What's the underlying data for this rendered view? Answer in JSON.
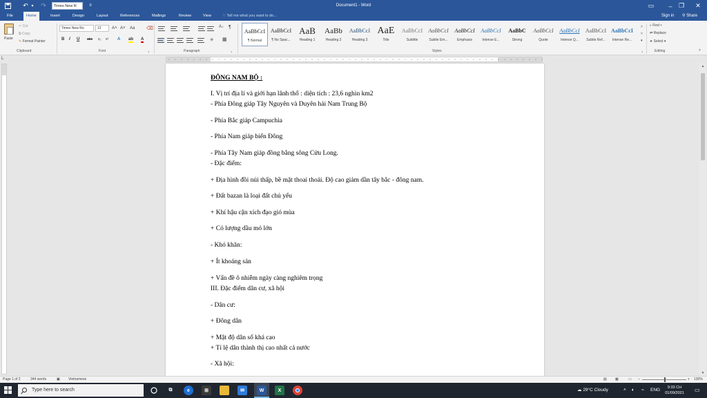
{
  "titlebar": {
    "font_quick": "Times New R",
    "doc_title": "Document1 - Word"
  },
  "tabs": {
    "file": "File",
    "items": [
      "Home",
      "Insert",
      "Design",
      "Layout",
      "References",
      "Mailings",
      "Review",
      "View"
    ],
    "tellme": "Tell me what you want to do...",
    "signin": "Sign in",
    "share": "Share"
  },
  "ribbon": {
    "clipboard": {
      "paste": "Paste",
      "cut": "Cut",
      "copy": "Copy",
      "format_painter": "Format Painter",
      "label": "Clipboard"
    },
    "font": {
      "name": "Times New Ro",
      "size": "12",
      "label": "Font"
    },
    "paragraph": {
      "label": "Paragraph"
    },
    "styles": {
      "label": "Styles",
      "items": [
        {
          "sample": "AaBbCcI",
          "name": "¶ Normal"
        },
        {
          "sample": "AaBbCcI",
          "name": "¶ No Spac..."
        },
        {
          "sample": "AaB",
          "name": "Heading 1"
        },
        {
          "sample": "AaBb",
          "name": "Heading 2"
        },
        {
          "sample": "AaBbCcI",
          "name": "Heading 3"
        },
        {
          "sample": "AaE",
          "name": "Title"
        },
        {
          "sample": "AaBbCcI",
          "name": "Subtitle"
        },
        {
          "sample": "AaBbCcI",
          "name": "Subtle Em..."
        },
        {
          "sample": "AaBbCcI",
          "name": "Emphasis"
        },
        {
          "sample": "AaBbCcI",
          "name": "Intense E..."
        },
        {
          "sample": "AaBbC",
          "name": "Strong"
        },
        {
          "sample": "AaBbCcI",
          "name": "Quote"
        },
        {
          "sample": "AaBbCcI",
          "name": "Intense Q..."
        },
        {
          "sample": "AaBbCcI",
          "name": "Subtle Ref..."
        },
        {
          "sample": "AaBbCcI",
          "name": "Intense Re..."
        }
      ]
    },
    "editing": {
      "find": "Find",
      "replace": "Replace",
      "select": "Select",
      "label": "Editing"
    }
  },
  "document": {
    "lines": [
      "ĐÔNG NAM BỘ :",
      "I. Vị trí địa lí và giới hạn lãnh thổ : diện tích : 23,6 nghìn km2",
      "-  Phía Đông giáp Tây Nguyên và Duyên hải Nam Trung Bộ",
      "- Phía Bắc giáp Campuchia",
      "- Phía Nam giáp biển Đông",
      "- Phía Tây Nam giáp đồng bằng sông Cửu Long.",
      "- Đặc điểm:",
      "+ Địa hình đồi núi thấp, bề mặt thoai thoải. Độ cao giảm dần tây bắc - đông nam.",
      "+ Đất bazan là loại đất chủ yếu",
      "+ Khí hậu cận xích đạo gió mùa",
      "+ Có lượng dầu mỏ lớn",
      "- Khó khăn:",
      "+ Ít khoáng sản",
      "+ Vấn đề ô nhiễm ngày càng nghiêm trọng",
      "III. Đặc điểm dân cư, xã hội",
      "- Dân cư:",
      "+ Đông dân",
      "+ Mật độ dân số khá cao",
      "+ Tỉ lệ dân thành thị cao nhất cả nước",
      "- Xã hội:"
    ]
  },
  "status": {
    "page": "Page 1 of 2",
    "words": "344 words",
    "language": "Vietnamese",
    "zoom": "130%"
  },
  "taskbar": {
    "search": "Type here to search",
    "weather": "29°C  Cloudy",
    "lang": "ENG",
    "time": "9:33 CH",
    "date": "01/09/2021"
  }
}
